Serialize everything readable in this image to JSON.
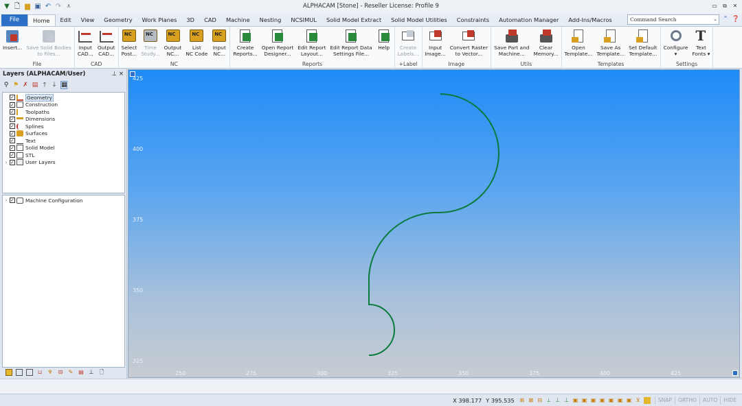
{
  "app": {
    "title": "ALPHACAM [Stone] - Reseller License: Profile 9",
    "qat_icons": [
      "alphacam-logo-icon",
      "new-file-icon",
      "open-folder-icon",
      "save-icon",
      "undo-icon",
      "redo-icon",
      "customize-icon"
    ],
    "window_controls": [
      "minimize-icon",
      "restore-icon",
      "close-icon"
    ]
  },
  "tabs": {
    "file": "File",
    "items": [
      "Home",
      "Edit",
      "View",
      "Geometry",
      "Work Planes",
      "3D",
      "CAD",
      "Machine",
      "Nesting",
      "NCSIMUL",
      "Solid Model Extract",
      "Solid Model Utilities",
      "Constraints",
      "Automation Manager",
      "Add-Ins/Macros"
    ],
    "active": "Home",
    "command_search": "Command Search"
  },
  "ribbon": {
    "groups": [
      {
        "label": "File",
        "buttons": [
          {
            "l1": "Insert...",
            "l2": "",
            "icon": "insert-icon",
            "enabled": true
          },
          {
            "l1": "Save Solid Bodies",
            "l2": "to Files...",
            "icon": "save-solid-bodies-icon",
            "enabled": false
          }
        ]
      },
      {
        "label": "CAD",
        "buttons": [
          {
            "l1": "Input",
            "l2": "CAD...",
            "icon": "input-cad-icon",
            "enabled": true
          },
          {
            "l1": "Output",
            "l2": "CAD...",
            "icon": "output-cad-icon",
            "enabled": true
          }
        ]
      },
      {
        "label": "NC",
        "buttons": [
          {
            "l1": "Select",
            "l2": "Post...",
            "icon": "select-post-icon",
            "enabled": true
          },
          {
            "l1": "Time",
            "l2": "Study...",
            "icon": "time-study-icon",
            "enabled": false
          },
          {
            "l1": "Output",
            "l2": "NC...",
            "icon": "output-nc-icon",
            "enabled": true
          },
          {
            "l1": "List",
            "l2": "NC Code",
            "icon": "list-nc-code-icon",
            "enabled": true
          },
          {
            "l1": "Input",
            "l2": "NC...",
            "icon": "input-nc-icon",
            "enabled": true
          }
        ]
      },
      {
        "label": "Reports",
        "buttons": [
          {
            "l1": "Create",
            "l2": "Reports...",
            "icon": "create-reports-icon",
            "enabled": true
          },
          {
            "l1": "Open Report",
            "l2": "Designer...",
            "icon": "open-report-designer-icon",
            "enabled": true
          },
          {
            "l1": "Edit Report",
            "l2": "Layout...",
            "icon": "edit-report-layout-icon",
            "enabled": true
          },
          {
            "l1": "Edit Report Data",
            "l2": "Settings File...",
            "icon": "edit-report-data-icon",
            "enabled": true
          },
          {
            "l1": "Help",
            "l2": "",
            "icon": "report-help-icon",
            "enabled": true
          }
        ]
      },
      {
        "label": "+Label",
        "buttons": [
          {
            "l1": "Create",
            "l2": "Labels...",
            "icon": "create-labels-icon",
            "enabled": false
          }
        ]
      },
      {
        "label": "Image",
        "buttons": [
          {
            "l1": "Input",
            "l2": "Image...",
            "icon": "input-image-icon",
            "enabled": true
          },
          {
            "l1": "Convert Raster",
            "l2": "to Vector...",
            "icon": "convert-raster-icon",
            "enabled": true
          }
        ]
      },
      {
        "label": "Utils",
        "buttons": [
          {
            "l1": "Save Part and",
            "l2": "Machine...",
            "icon": "save-part-machine-icon",
            "enabled": true
          },
          {
            "l1": "Clear",
            "l2": "Memory...",
            "icon": "clear-memory-icon",
            "enabled": true
          }
        ]
      },
      {
        "label": "Templates",
        "buttons": [
          {
            "l1": "Open",
            "l2": "Template...",
            "icon": "open-template-icon",
            "enabled": true
          },
          {
            "l1": "Save As",
            "l2": "Template...",
            "icon": "save-as-template-icon",
            "enabled": true
          },
          {
            "l1": "Set Default",
            "l2": "Template...",
            "icon": "set-default-template-icon",
            "enabled": true
          }
        ]
      },
      {
        "label": "Settings",
        "buttons": [
          {
            "l1": "Configure",
            "l2": "▾",
            "icon": "configure-icon",
            "enabled": true
          },
          {
            "l1": "Text",
            "l2": "Fonts ▾",
            "icon": "text-fonts-icon",
            "enabled": true
          }
        ]
      }
    ]
  },
  "layers_panel": {
    "title": "Layers (ALPHACAM/User)",
    "pin": "⊥",
    "close": "×",
    "layers": [
      {
        "label": "Geometry",
        "icon": "geometry-icon",
        "selected": true,
        "expandable": false
      },
      {
        "label": "Construction",
        "icon": "construction-icon",
        "selected": false,
        "expandable": false
      },
      {
        "label": "Toolpaths",
        "icon": "toolpaths-icon",
        "selected": false,
        "expandable": false
      },
      {
        "label": "Dimensions",
        "icon": "dimensions-icon",
        "selected": false,
        "expandable": false
      },
      {
        "label": "Splines",
        "icon": "splines-icon",
        "selected": false,
        "expandable": false
      },
      {
        "label": "Surfaces",
        "icon": "surfaces-icon",
        "selected": false,
        "expandable": false
      },
      {
        "label": "Text",
        "icon": "text-layer-icon",
        "selected": false,
        "expandable": false
      },
      {
        "label": "Solid Model",
        "icon": "solid-model-icon",
        "selected": false,
        "expandable": false
      },
      {
        "label": "STL",
        "icon": "stl-icon",
        "selected": false,
        "expandable": false
      },
      {
        "label": "User Layers",
        "icon": "user-layers-icon",
        "selected": false,
        "expandable": true
      }
    ],
    "machine": {
      "label": "Machine Configuration",
      "icon": "machine-config-icon"
    }
  },
  "viewport": {
    "y_ticks": [
      "425",
      "400",
      "375",
      "350",
      "325"
    ],
    "x_ticks": [
      "250",
      "275",
      "300",
      "325",
      "350",
      "375",
      "400",
      "425"
    ],
    "curve_color": "#0a7a3c"
  },
  "status": {
    "x": "X 398.177",
    "y": "Y 395.535",
    "modes": [
      "SNAP",
      "ORTHO",
      "AUTO",
      "HIDE"
    ]
  }
}
